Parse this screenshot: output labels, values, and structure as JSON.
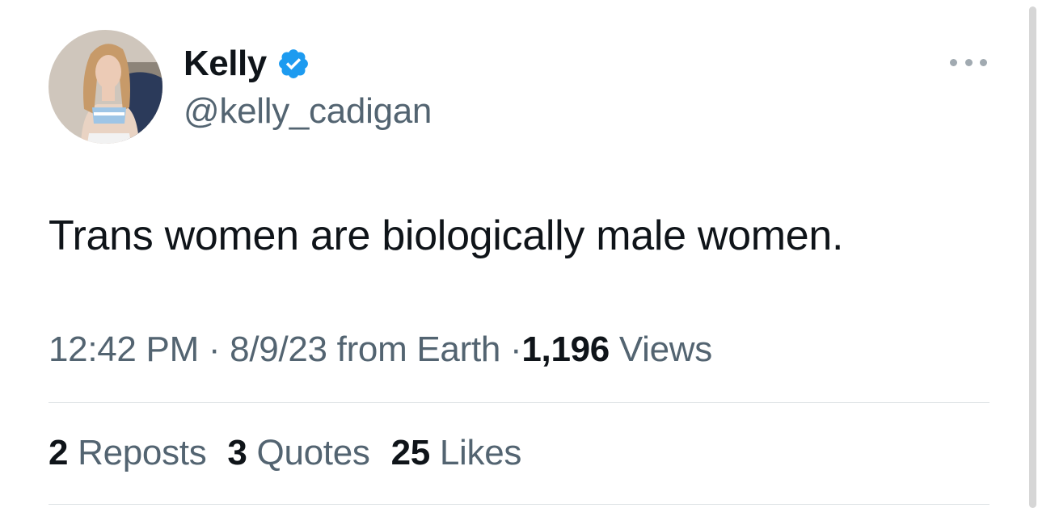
{
  "author": {
    "display_name": "Kelly",
    "handle": "@kelly_cadigan",
    "verified_icon": "verified-badge-icon",
    "verified_color": "#1d9bf0"
  },
  "tweet": {
    "text": "Trans women are biologically male women."
  },
  "meta": {
    "time": "12:42 PM",
    "separator": "·",
    "date": "8/9/23",
    "source": "from Earth",
    "views_count": "1,196",
    "views_label": "Views"
  },
  "stats": [
    {
      "count": "2",
      "label": "Reposts"
    },
    {
      "count": "3",
      "label": "Quotes"
    },
    {
      "count": "25",
      "label": "Likes"
    }
  ],
  "colors": {
    "text_primary": "#0f1419",
    "text_secondary": "#536471",
    "divider": "#dfe3e6",
    "accent": "#1d9bf0"
  }
}
